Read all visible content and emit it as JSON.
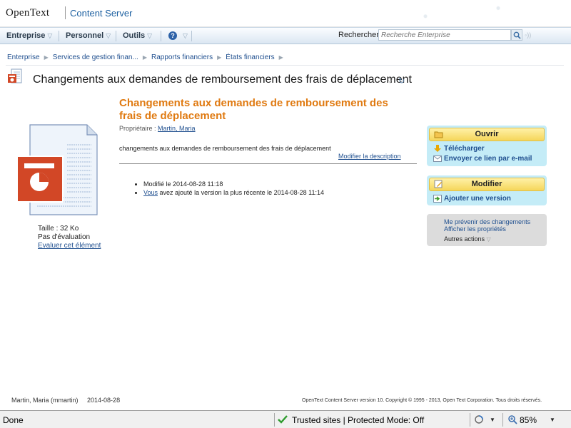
{
  "header": {
    "logo": "OpenText",
    "product": "Content Server"
  },
  "nav": {
    "items": [
      "Entreprise",
      "Personnel",
      "Outils"
    ],
    "search_label": "Rechercher",
    "search_placeholder": "Recherche Enterprise"
  },
  "breadcrumb": [
    "Enterprise",
    "Services de gestion finan...",
    "Rapports financiers",
    "États financiers"
  ],
  "page": {
    "title": "Changements aux demandes de remboursement des frais de déplacement"
  },
  "document": {
    "heading": "Changements aux demandes de remboursement des frais de déplacement",
    "owner_label": "Propriétaire :",
    "owner": "Martin, Maria",
    "description": "changements aux demandes de remboursement des frais de déplacement",
    "modify_description": "Modifier la description",
    "size_label": "Taille :",
    "size": "32 Ko",
    "rating": "Pas d'évaluation",
    "rate_link": "Evaluer cet élément",
    "history": {
      "modified": "Modifié le 2014-08-28 11:18",
      "you": "Vous",
      "version_text": " avez ajouté la version la plus récente le 2014-08-28 11:14"
    }
  },
  "actions": {
    "open": "Ouvrir",
    "download": "Télécharger",
    "email_link": "Envoyer ce lien par e-mail",
    "edit": "Modifier",
    "add_version": "Ajouter une version",
    "notify": "Me prévenir des changements",
    "properties": "Afficher les propriétés",
    "more": "Autres actions"
  },
  "footer": {
    "user": "Martin, Maria (mmartin)",
    "date": "2014-08-28",
    "copyright": "OpenText Content Server version 10. Copyright © 1995 - 2013, Open Text Corporation. Tous droits réservés."
  },
  "status": {
    "done": "Done",
    "zone": "Trusted sites | Protected Mode: Off",
    "zoom": "85%"
  },
  "colors": {
    "accent_orange": "#e07a11",
    "link_blue": "#1f4f8f",
    "panel_cyan": "#c4ecf7",
    "button_yellow": "#f5d65a"
  }
}
